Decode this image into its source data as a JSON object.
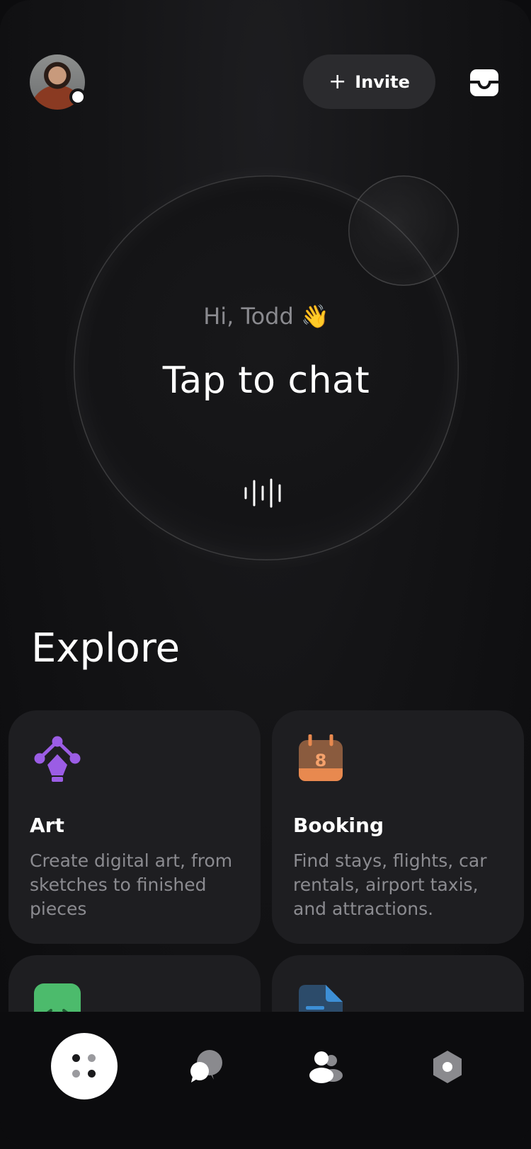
{
  "header": {
    "avatar_alt": "profile photo",
    "invite_label": "Invite",
    "invite_icon": "plus-icon",
    "inbox_icon": "inbox-icon"
  },
  "hero": {
    "greeting": "Hi, Todd 👋",
    "title": "Tap to chat",
    "voice_icon": "voice-waveform-icon"
  },
  "explore": {
    "title": "Explore",
    "cards": [
      {
        "icon": "art-pen-tool-icon",
        "icon_color": "#9b5de5",
        "title": "Art",
        "description": "Create digital art, from sketches to finished pieces"
      },
      {
        "icon": "calendar-icon",
        "icon_color": "#e8894f",
        "icon_text": "8",
        "title": "Booking",
        "description": "Find stays, flights, car rentals, airport taxis, and attractions."
      },
      {
        "icon": "code-icon",
        "icon_color": "#4cbb6c",
        "title": "",
        "description": ""
      },
      {
        "icon": "document-icon",
        "icon_color": "#3d8fd6",
        "title": "",
        "description": ""
      }
    ]
  },
  "nav": {
    "items": [
      {
        "name": "home",
        "icon": "grid-dots-icon",
        "active": true
      },
      {
        "name": "chats",
        "icon": "chat-bubbles-icon",
        "active": false
      },
      {
        "name": "people",
        "icon": "people-icon",
        "active": false
      },
      {
        "name": "settings",
        "icon": "hexagon-settings-icon",
        "active": false
      }
    ]
  }
}
